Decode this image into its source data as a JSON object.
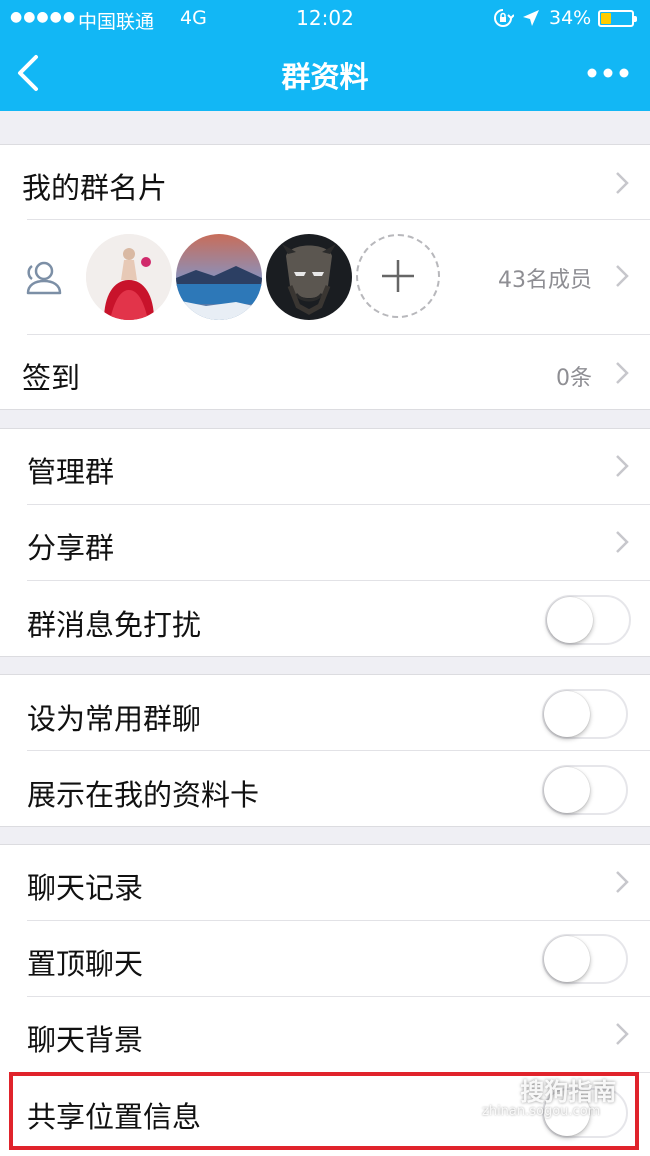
{
  "status_bar": {
    "signal": "●●●●●",
    "carrier": "中国联通",
    "network": "4G",
    "time": "12:02",
    "battery_percent": "34%",
    "battery_level": 0.34,
    "icons": [
      "orientation-lock-icon",
      "location-arrow-icon",
      "battery-icon"
    ]
  },
  "nav": {
    "title": "群资料",
    "back_icon": "chevron-left-icon",
    "more_icon": "more-dots-icon"
  },
  "group_section": {
    "card_label": "我的群名片",
    "members_icon": "members-icon",
    "member_count": "43名成员",
    "add_icon": "plus-icon",
    "checkin_label": "签到",
    "checkin_count": "0条"
  },
  "manage_section": {
    "manage_label": "管理群",
    "share_label": "分享群",
    "mute_label": "群消息免打扰",
    "mute_on": false
  },
  "favorite_section": {
    "favorite_label": "设为常用群聊",
    "favorite_on": false,
    "show_card_label": "展示在我的资料卡",
    "show_card_on": false
  },
  "chat_section": {
    "history_label": "聊天记录",
    "pin_label": "置顶聊天",
    "pin_on": false,
    "background_label": "聊天背景",
    "share_location_label": "共享位置信息",
    "share_location_on": false
  },
  "watermark": {
    "text": "搜狗指南",
    "url": "zhinan.sogou.com"
  },
  "colors": {
    "nav_bar": "#12b7f5",
    "highlight": "#e0232b",
    "battery_fill": "#ffcc00",
    "background": "#efeff4"
  }
}
